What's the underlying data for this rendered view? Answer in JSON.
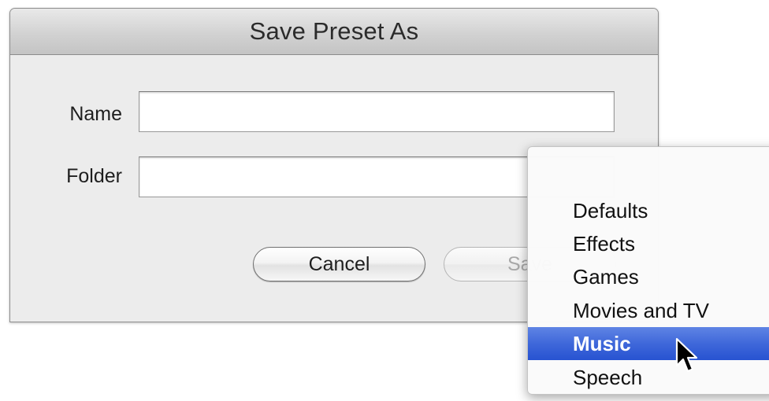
{
  "dialog": {
    "title": "Save Preset As",
    "name_label": "Name",
    "name_value": "",
    "folder_label": "Folder",
    "folder_value": "",
    "cancel_label": "Cancel",
    "save_label": "Save"
  },
  "folder_menu": {
    "items": [
      {
        "label": "Defaults",
        "selected": false
      },
      {
        "label": "Effects",
        "selected": false
      },
      {
        "label": "Games",
        "selected": false
      },
      {
        "label": "Movies and TV",
        "selected": false
      },
      {
        "label": "Music",
        "selected": true
      },
      {
        "label": "Speech",
        "selected": false
      }
    ],
    "highlight_color": "#3f68da"
  },
  "cursor": {
    "icon": "arrow-pointer-icon"
  }
}
